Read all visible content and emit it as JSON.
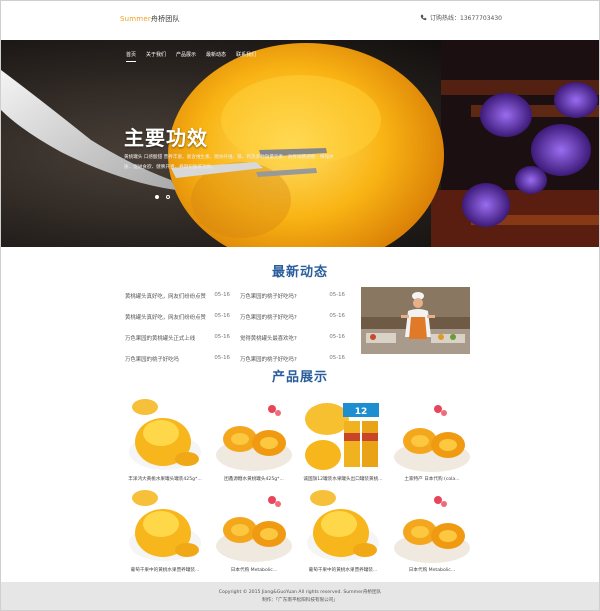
{
  "header": {
    "logo_en": "Summer",
    "logo_cn": "舟桥团队",
    "hotline": "订购热线：13677703430"
  },
  "nav": [
    "首页",
    "关于我们",
    "产品展示",
    "最新动态",
    "联系我们"
  ],
  "banner": {
    "title": "主要功效",
    "desc": "黄桃罐头 口感酸甜 营养丰富，富含维生素、膳食纤维、铁、钙及多种微量元素，具有润肠通便、增强体质、促进食欲、健脾开胃、养颜护肤等功效。"
  },
  "sections": {
    "news_title": "最新动态",
    "products_title": "产品展示"
  },
  "news": [
    [
      {
        "title": "黄桃罐头真好吃，网友们纷纷点赞",
        "date": "05-16"
      },
      {
        "title": "万色果园的桃子好吃吗?",
        "date": "05-16"
      }
    ],
    [
      {
        "title": "黄桃罐头真好吃，网友们纷纷点赞",
        "date": "05-16"
      },
      {
        "title": "万色果园的桃子好吃吗?",
        "date": "05-16"
      }
    ],
    [
      {
        "title": "万色果园的黄桃罐头正式上线",
        "date": "05-16"
      },
      {
        "title": "觉得黄桃罐头最喜欢吃?",
        "date": "05-16"
      }
    ],
    [
      {
        "title": "万色果园的桃子好吃吗",
        "date": "05-16"
      },
      {
        "title": "万色果园的桃子好吃吗?",
        "date": "05-16"
      }
    ]
  ],
  "products": [
    {
      "caption": "丰泽鸿大黄桃水果罐头罐装425g*..."
    },
    {
      "caption": "团鑫源糖水黄桃罐头425g*..."
    },
    {
      "caption": "诚国旗12罐装水果罐头出口罐装黄桃..."
    },
    {
      "caption": "土家特产 日本代购 (cola..."
    },
    {
      "caption": "葡萄干果中的黄桃水果营养罐装..."
    },
    {
      "caption": "日本代购 Metabolic..."
    },
    {
      "caption": "葡萄干果中的黄桃水果营养罐装..."
    },
    {
      "caption": "日本代购 Metabolic..."
    }
  ],
  "footer": {
    "line1": "Copyright © 2015 Jiang&GuoYuan All rights reserved. Summer舟桥团队",
    "line2": "制作：「广东南平松阳科技有限公司」"
  },
  "colors": {
    "accent": "#2a5d9c",
    "logo": "#f0a020",
    "footer_bg": "#e6e6e6"
  }
}
